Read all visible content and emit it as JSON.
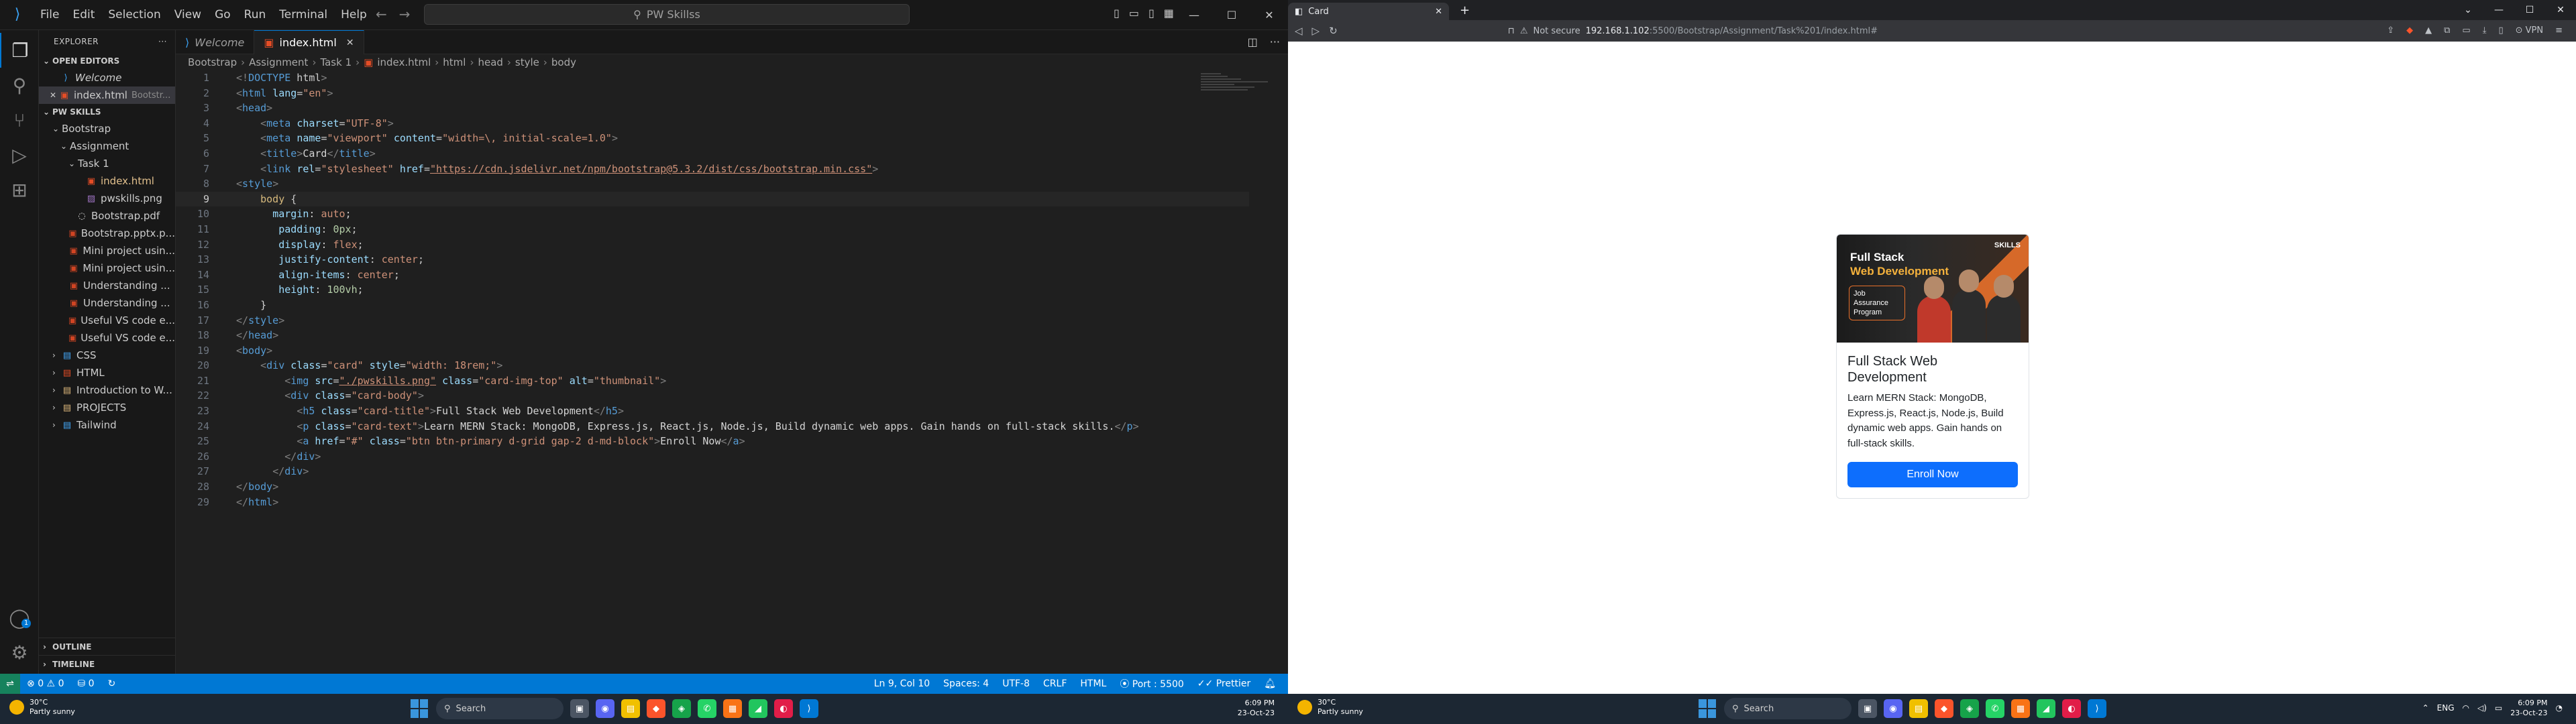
{
  "vscode": {
    "menu": [
      "File",
      "Edit",
      "Selection",
      "View",
      "Go",
      "Run",
      "Terminal",
      "Help"
    ],
    "search": "PW Skillss",
    "explorer": {
      "title": "EXPLORER",
      "open_editors": "OPEN EDITORS",
      "open_files": [
        {
          "name": "Welcome",
          "detail": ""
        },
        {
          "name": "index.html",
          "detail": "Bootstr..."
        }
      ],
      "workspace": "PW SKILLS",
      "tree": [
        {
          "label": "Bootstrap"
        },
        {
          "label": "Assignment"
        },
        {
          "label": "Task 1"
        },
        {
          "label": "index.html"
        },
        {
          "label": "pwskills.png"
        },
        {
          "label": "Bootstrap.pdf"
        },
        {
          "label": "Bootstrap.pptx.p..."
        },
        {
          "label": "Mini project usin..."
        },
        {
          "label": "Mini project usin..."
        },
        {
          "label": "Understanding ..."
        },
        {
          "label": "Understanding ..."
        },
        {
          "label": "Useful VS code e..."
        },
        {
          "label": "Useful VS code e..."
        },
        {
          "label": "CSS"
        },
        {
          "label": "HTML"
        },
        {
          "label": "Introduction to W..."
        },
        {
          "label": "PROJECTS"
        },
        {
          "label": "Tailwind"
        }
      ],
      "outline": "OUTLINE",
      "timeline": "TIMELINE"
    },
    "tabs": [
      {
        "label": "Welcome"
      },
      {
        "label": "index.html"
      }
    ],
    "breadcrumb": [
      "Bootstrap",
      "Assignment",
      "Task 1",
      "index.html",
      "html",
      "head",
      "style",
      "body"
    ],
    "code_lines": [
      "<!DOCTYPE html>",
      "<html lang=\"en\">",
      "<head>",
      "    <meta charset=\"UTF-8\">",
      "    <meta name=\"viewport\" content=\"width=\\, initial-scale=1.0\">",
      "    <title>Card</title>",
      "    <link rel=\"stylesheet\" href=\"https://cdn.jsdelivr.net/npm/bootstrap@5.3.2/dist/css/bootstrap.min.css\">",
      "<style>",
      "    body {",
      "      margin: auto;",
      "       padding: 0px;",
      "       display: flex;",
      "       justify-content: center;",
      "       align-items: center;",
      "       height: 100vh;",
      "    }",
      "</style>",
      "</head>",
      "<body>",
      "    <div class=\"card\" style=\"width: 18rem;\">",
      "        <img src=\"./pwskills.png\" class=\"card-img-top\" alt=\"thumbnail\">",
      "        <div class=\"card-body\">",
      "          <h5 class=\"card-title\">Full Stack Web Development</h5>",
      "          <p class=\"card-text\">Learn MERN Stack: MongoDB, Express.js, React.js, Node.js, Build dynamic web apps. Gain hands on full-stack skills.</p>",
      "          <a href=\"#\" class=\"btn btn-primary d-grid gap-2 d-md-block\">Enroll Now</a>",
      "        </div>",
      "      </div>",
      "</body>",
      "</html>"
    ],
    "status": {
      "errors": "0",
      "warnings": "0",
      "ports": "0",
      "position": "Ln 9, Col 10",
      "spaces": "Spaces: 4",
      "encoding": "UTF-8",
      "eol": "CRLF",
      "language": "HTML",
      "port": "Port : 5500",
      "formatter": "Prettier"
    }
  },
  "browser": {
    "tab_title": "Card",
    "url_security": "Not secure",
    "url_host": "192.168.1.102",
    "url_path": ":5500/Bootstrap/Assignment/Task%201/index.html#",
    "vpn": "VPN",
    "card": {
      "image_title1": "Full Stack",
      "image_title2": "Web Development",
      "image_badge": "Job Assurance Program",
      "image_logo": "SKILLS",
      "title": "Full Stack Web Development",
      "text": "Learn MERN Stack: MongoDB, Express.js, React.js, Node.js, Build dynamic web apps. Gain hands on full-stack skills.",
      "button": "Enroll Now"
    }
  },
  "taskbar_left": {
    "temp": "30°C",
    "weather": "Partly sunny",
    "search": "Search",
    "time": "6:09 PM",
    "date": "23-Oct-23"
  },
  "taskbar_right": {
    "temp": "30°C",
    "weather": "Partly sunny",
    "search": "Search",
    "lang": "ENG",
    "time": "6:09 PM",
    "date": "23-Oct-23"
  }
}
